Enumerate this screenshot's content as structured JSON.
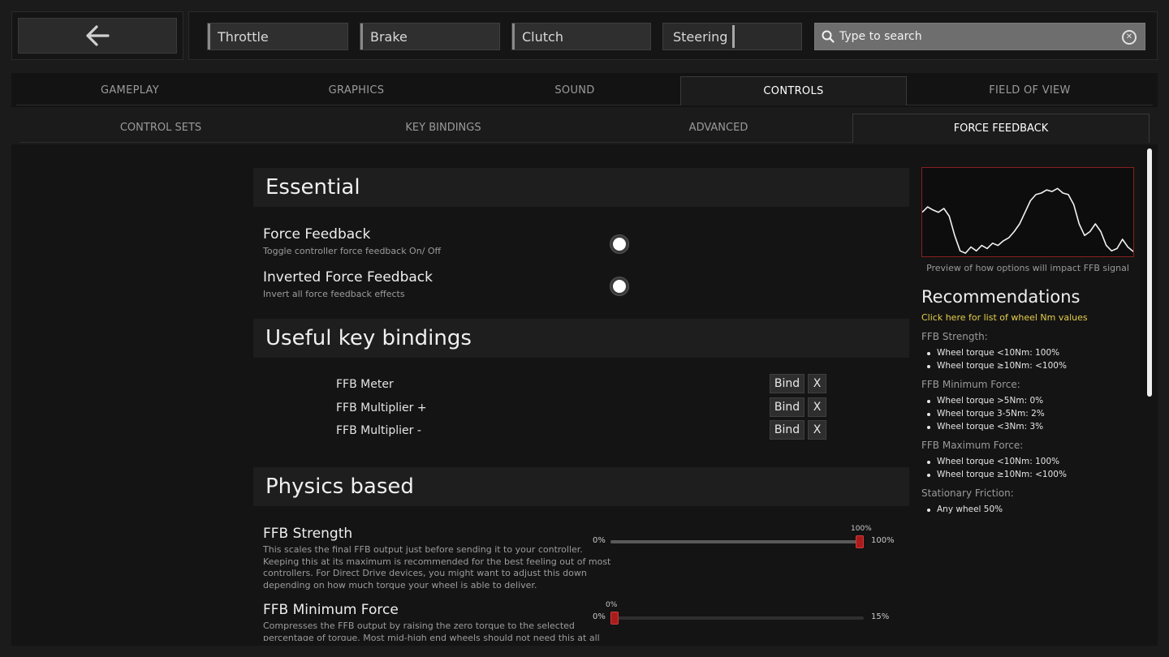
{
  "topbar": {
    "axes": [
      {
        "label": "Throttle",
        "value": 0.0
      },
      {
        "label": "Brake",
        "value": 0.0
      },
      {
        "label": "Clutch",
        "value": 0.0
      },
      {
        "label": "Steering",
        "value": 0.5
      }
    ],
    "search": {
      "placeholder": "Type to search",
      "value": ""
    }
  },
  "tabs": [
    "GAMEPLAY",
    "GRAPHICS",
    "SOUND",
    "CONTROLS",
    "FIELD OF VIEW"
  ],
  "active_tab": "CONTROLS",
  "subtabs": [
    "CONTROL SETS",
    "KEY BINDINGS",
    "ADVANCED",
    "FORCE FEEDBACK"
  ],
  "active_subtab": "FORCE FEEDBACK",
  "sections": {
    "essential": {
      "title": "Essential",
      "options": [
        {
          "title": "Force Feedback",
          "desc": "Toggle controller force feedback On/ Off",
          "enabled": true
        },
        {
          "title": "Inverted Force Feedback",
          "desc": "Invert all force feedback effects",
          "enabled": true
        }
      ]
    },
    "keybindings": {
      "title": "Useful key bindings",
      "bind_label": "Bind",
      "clear_label": "X",
      "items": [
        "FFB Meter",
        "FFB Multiplier +",
        "FFB Multiplier -"
      ]
    },
    "physics": {
      "title": "Physics based",
      "options": [
        {
          "title": "FFB Strength",
          "desc": [
            "This scales the final FFB output just before sending it to your controller.",
            "Keeping this at its maximum is recommended for the best feeling out of most",
            "controllers. For Direct Drive devices, you might want to adjust this down",
            "depending on how much torque your wheel is able to deliver."
          ],
          "min_label": "0%",
          "max_label": "100%",
          "value_label": "100%",
          "value": 1.0
        },
        {
          "title": "FFB Minimum Force",
          "desc": [
            "Compresses the FFB output by raising the zero torque to the selected",
            "percentage of torque. Most mid-high end wheels should not need this at all"
          ],
          "min_label": "0%",
          "max_label": "15%",
          "value_label": "0%",
          "value": 0.0
        }
      ]
    }
  },
  "preview": {
    "caption": "Preview of how options will impact FFB signal",
    "signal": [
      0.55,
      0.62,
      0.58,
      0.55,
      0.6,
      0.5,
      0.25,
      0.05,
      0.02,
      0.1,
      0.05,
      0.12,
      0.08,
      0.15,
      0.12,
      0.18,
      0.22,
      0.3,
      0.4,
      0.55,
      0.7,
      0.78,
      0.8,
      0.84,
      0.82,
      0.86,
      0.8,
      0.78,
      0.65,
      0.4,
      0.25,
      0.3,
      0.4,
      0.3,
      0.12,
      0.05,
      0.08,
      0.2,
      0.1,
      0.04
    ]
  },
  "recommendations": {
    "title": "Recommendations",
    "link": "Click here for list of wheel Nm values",
    "groups": [
      {
        "heading": "FFB Strength:",
        "items": [
          "Wheel torque <10Nm: 100%",
          "Wheel torque ≥10Nm: <100%"
        ]
      },
      {
        "heading": "FFB Minimum Force:",
        "items": [
          "Wheel torque >5Nm: 0%",
          "Wheel torque 3-5Nm: 2%",
          "Wheel torque <3Nm: 3%"
        ]
      },
      {
        "heading": "FFB Maximum Force:",
        "items": [
          "Wheel torque <10Nm: 100%",
          "Wheel torque ≥10Nm: <100%"
        ]
      },
      {
        "heading": "Stationary Friction:",
        "items": [
          "Any wheel 50%"
        ]
      }
    ]
  },
  "colors": {
    "accent": "#a81c1c",
    "link": "#e6cf4a",
    "graph_border": "#8a1f1f"
  }
}
